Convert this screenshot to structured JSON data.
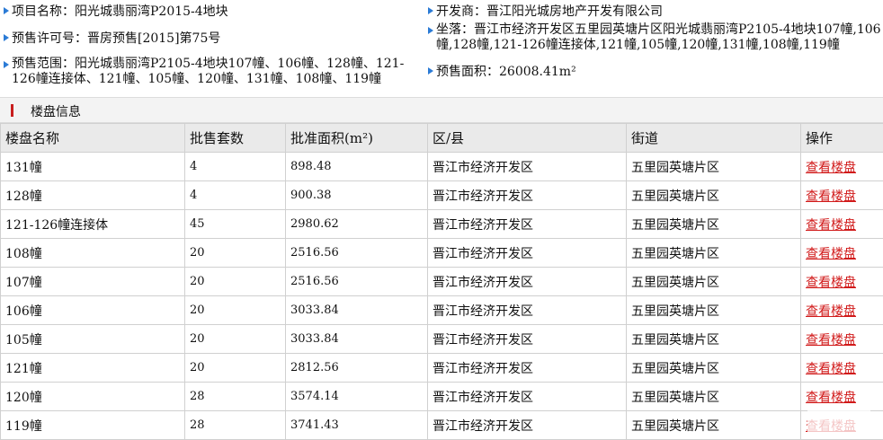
{
  "info": {
    "project_name": "项目名称：阳光城翡丽湾P2015-4地块",
    "presale_permit": "预售许可号：晋房预售[2015]第75号",
    "presale_scope": "预售范围：阳光城翡丽湾P2105-4地块107幢、106幢、128幢、121-126幢连接体、121幢、105幢、120幢、131幢、108幢、119幢",
    "developer": "开发商：晋江阳光城房地产开发有限公司",
    "location": "坐落：晋江市经济开发区五里园英塘片区阳光城翡丽湾P2105-4地块107幢,106幢,128幢,121-126幢连接体,121幢,105幢,120幢,131幢,108幢,119幢",
    "presale_area": "预售面积：26008.41m²"
  },
  "section_title": "楼盘信息",
  "table": {
    "headers": [
      "楼盘名称",
      "批售套数",
      "批准面积(m²)",
      "区/县",
      "街道",
      "操作"
    ],
    "rows": [
      {
        "name": "131幢",
        "units": "4",
        "area": "898.48",
        "district": "晋江市经济开发区",
        "street": "五里园英塘片区",
        "action": "查看楼盘"
      },
      {
        "name": "128幢",
        "units": "4",
        "area": "900.38",
        "district": "晋江市经济开发区",
        "street": "五里园英塘片区",
        "action": "查看楼盘"
      },
      {
        "name": "121-126幢连接体",
        "units": "45",
        "area": "2980.62",
        "district": "晋江市经济开发区",
        "street": "五里园英塘片区",
        "action": "查看楼盘"
      },
      {
        "name": "108幢",
        "units": "20",
        "area": "2516.56",
        "district": "晋江市经济开发区",
        "street": "五里园英塘片区",
        "action": "查看楼盘"
      },
      {
        "name": "107幢",
        "units": "20",
        "area": "2516.56",
        "district": "晋江市经济开发区",
        "street": "五里园英塘片区",
        "action": "查看楼盘"
      },
      {
        "name": "106幢",
        "units": "20",
        "area": "3033.84",
        "district": "晋江市经济开发区",
        "street": "五里园英塘片区",
        "action": "查看楼盘"
      },
      {
        "name": "105幢",
        "units": "20",
        "area": "3033.84",
        "district": "晋江市经济开发区",
        "street": "五里园英塘片区",
        "action": "查看楼盘"
      },
      {
        "name": "121幢",
        "units": "20",
        "area": "2812.56",
        "district": "晋江市经济开发区",
        "street": "五里园英塘片区",
        "action": "查看楼盘"
      },
      {
        "name": "120幢",
        "units": "28",
        "area": "3574.14",
        "district": "晋江市经济开发区",
        "street": "五里园英塘片区",
        "action": "查看楼盘"
      },
      {
        "name": "119幢",
        "units": "28",
        "area": "3741.43",
        "district": "晋江市经济开发区",
        "street": "五里园英塘片区",
        "action": "查看楼盘"
      }
    ]
  },
  "colors": {
    "accent_icon": "#2b7bd6",
    "link": "#d11a1a",
    "section_bar": "#c81e1e"
  },
  "icons": {
    "bullet": "blue-triangle-icon"
  }
}
